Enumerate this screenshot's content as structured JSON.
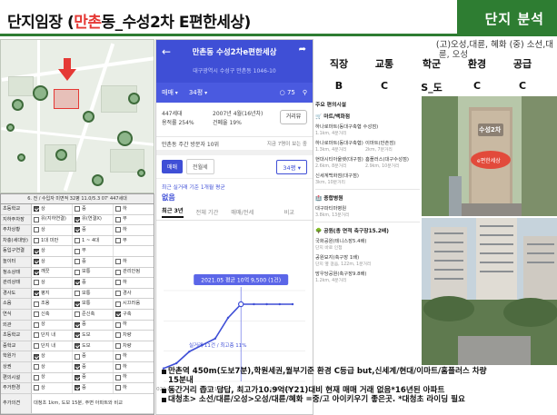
{
  "header": {
    "title_prefix": "단지임장 (",
    "title_highlight": "만촌",
    "title_rest": "동_수성2차 E편한세상)",
    "section_label": "단지 분석"
  },
  "description": {
    "line1": "(고)오성,대륜, 혜화 (중) 소선,대",
    "line2": "륜, 오성"
  },
  "grades": {
    "headers": [
      "직장",
      "교통",
      "학군",
      "환경",
      "공급"
    ],
    "values": [
      "B",
      "C",
      "S_도",
      "C",
      "C"
    ]
  },
  "checklist": {
    "header": "6. 전 / 수입자 미면적 32평 11.0/5.3 07' 447세대",
    "rows": [
      {
        "label": "초등학교",
        "cells": [
          {
            "text": "상",
            "checked": true
          },
          {
            "text": "중",
            "checked": false
          },
          {
            "text": "하",
            "checked": false
          }
        ]
      },
      {
        "label": "지하주차장",
        "cells": [
          {
            "text": "유(지하연결)",
            "checked": false
          },
          {
            "text": "유(연결X)",
            "checked": true
          },
          {
            "text": "무",
            "checked": false
          }
        ]
      },
      {
        "label": "주차상황",
        "cells": [
          {
            "text": "상",
            "checked": false
          },
          {
            "text": "중",
            "checked": true
          },
          {
            "text": "하",
            "checked": false
          }
        ]
      },
      {
        "label": "차충(세대당)",
        "cells": [
          {
            "text": "1대 미만",
            "checked": false
          },
          {
            "text": "1 ~ 4대",
            "checked": false
          },
          {
            "text": "무",
            "checked": false
          }
        ]
      },
      {
        "label": "동입구연결",
        "cells": [
          {
            "text": "상",
            "checked": true
          },
          {
            "text": "무",
            "checked": false
          },
          {
            "text": "",
            "checked": false
          }
        ]
      },
      {
        "label": "놀이터",
        "cells": [
          {
            "text": "상",
            "checked": true
          },
          {
            "text": "중",
            "checked": false
          },
          {
            "text": "하",
            "checked": false
          }
        ]
      },
      {
        "label": "청소상태",
        "cells": [
          {
            "text": "깨끗",
            "checked": true
          },
          {
            "text": "보통",
            "checked": false
          },
          {
            "text": "관리안됨",
            "checked": false
          }
        ]
      },
      {
        "label": "관리상태",
        "cells": [
          {
            "text": "상",
            "checked": false
          },
          {
            "text": "중",
            "checked": true
          },
          {
            "text": "하",
            "checked": false
          }
        ]
      },
      {
        "label": "경사도",
        "cells": [
          {
            "text": "평지",
            "checked": true
          },
          {
            "text": "보통",
            "checked": false
          },
          {
            "text": "경사",
            "checked": false
          }
        ]
      },
      {
        "label": "소음",
        "cells": [
          {
            "text": "조용",
            "checked": false
          },
          {
            "text": "보통",
            "checked": true
          },
          {
            "text": "시끄러움",
            "checked": false
          }
        ]
      },
      {
        "label": "연식",
        "cells": [
          {
            "text": "신축",
            "checked": false
          },
          {
            "text": "준신축",
            "checked": false
          },
          {
            "text": "구축",
            "checked": true
          }
        ]
      },
      {
        "label": "외관",
        "cells": [
          {
            "text": "상",
            "checked": false
          },
          {
            "text": "중",
            "checked": true
          },
          {
            "text": "하",
            "checked": false
          }
        ]
      },
      {
        "label": "초등학교",
        "cells": [
          {
            "text": "단지 내",
            "checked": false
          },
          {
            "text": "도보",
            "checked": true
          },
          {
            "text": "차량",
            "checked": false
          }
        ]
      },
      {
        "label": "중학교",
        "cells": [
          {
            "text": "단지 내",
            "checked": false
          },
          {
            "text": "도보",
            "checked": true
          },
          {
            "text": "차량",
            "checked": false
          }
        ]
      },
      {
        "label": "학원가",
        "cells": [
          {
            "text": "상",
            "checked": true
          },
          {
            "text": "중",
            "checked": false
          },
          {
            "text": "하",
            "checked": false
          }
        ]
      },
      {
        "label": "상권",
        "cells": [
          {
            "text": "상",
            "checked": false
          },
          {
            "text": "중",
            "checked": true
          },
          {
            "text": "하",
            "checked": false
          }
        ]
      },
      {
        "label": "편의시설",
        "cells": [
          {
            "text": "상",
            "checked": false
          },
          {
            "text": "중",
            "checked": true
          },
          {
            "text": "하",
            "checked": false
          }
        ]
      },
      {
        "label": "주거환경",
        "cells": [
          {
            "text": "상",
            "checked": false
          },
          {
            "text": "중",
            "checked": true
          },
          {
            "text": "하",
            "checked": false
          }
        ]
      }
    ],
    "memo_label": "추가의견",
    "memo_text": "대청초 1km, 도보 15분, 주변 아파트와 비교"
  },
  "app": {
    "title": "만촌동 수성2차e편한세상",
    "address": "대구광역시 수성구 만촌동 1046-10",
    "filter_type": "매매",
    "filter_size": "34평",
    "comment_count": "75",
    "households": "447세대",
    "floor_area_ratio": "용적률 254%",
    "build_date": "2007년 4월(16년차)",
    "coverage_ratio": "건폐율 19%",
    "distance_button": "거리뷰",
    "visitors_label": "만촌동 주간 방문자 10위",
    "visitors_more": "지금 7명이 보는 중",
    "tab_sale": "매매",
    "tab_rent": "전월세",
    "size_selector": "34평",
    "recent_price_label": "최근 실거래 기준 1개월 평균",
    "recent_price_value": "없음",
    "period_tabs": [
      "최근 3년",
      "전체 기간",
      "매매/전세",
      "비교"
    ],
    "tooltip": "2021.05 평균 10억 9,500 (1건)",
    "chart_note": "실거래 11건 / 최고층 11%"
  },
  "chart_data": {
    "type": "line",
    "title": "",
    "xlabel": "",
    "ylabel": "",
    "x": [
      "2020.01",
      "2020.04",
      "2020.07",
      "2020.10",
      "2021.01",
      "2021.03",
      "2021.05",
      "2021.08",
      "2021.11",
      "2022.01",
      "2022.04"
    ],
    "series": [
      {
        "values": [
          6.0,
          6.4,
          7.3,
          7.8,
          8.3,
          9.9,
          10.95,
          10.95,
          10.95,
          10.95,
          10.95
        ]
      }
    ],
    "x_ticks": [
      "2020.01",
      "2021.01",
      "2022.01"
    ],
    "ylim": [
      5,
      12
    ],
    "highlight_point": {
      "x": "2021.05",
      "y": 10.95
    }
  },
  "facilities": {
    "section_title": "주요 편의시설",
    "mart_title": "마트/백화점",
    "marts": [
      {
        "name": "하나로마트(동대구축협 수성점)",
        "dist": "1.1km, 4분거리"
      },
      {
        "name": "하나로마트(동대구축협)",
        "dist": "1.3km, 4분거리"
      },
      {
        "name": "현대시티아울렛(대구점)",
        "dist": "2.6km, 8분거리"
      },
      {
        "name": "신세계백화점(대구점)",
        "dist": "3km, 10분거리"
      }
    ],
    "marts_right": [
      {
        "name": "이마트(만촌점)",
        "dist": "2km, 7분거리"
      },
      {
        "name": "홈플러스(대구수성점)",
        "dist": "2.9km, 10분거리"
      }
    ],
    "hospital_title": "종합병원",
    "hospital": {
      "name": "대구파티마병원",
      "dist": "3.8km, 13분거리"
    },
    "park_title": "공원(총 면적 축구장15.2배)",
    "parks": [
      {
        "name": "국화공원(테니스장5.4배)",
        "dist": "단지 바로 인접"
      },
      {
        "name": "공원묘지(축구장 1배)",
        "dist": "단지 옆 걸음, 122m, 1분거리"
      },
      {
        "name": "망우당공원(축구장9.8배)",
        "dist": "1.2km, 4분거리"
      }
    ]
  },
  "photos": {
    "sign_text": "수성2차",
    "sign_brand": "e편한세상"
  },
  "notes": [
    {
      "bullet": true,
      "text": "만촌역 450m(도보7분),학원세권,월부기준 환경 C등급 but,신세계/현대/이마트/홈플러스 차량"
    },
    {
      "bullet": false,
      "text": "15분내"
    },
    {
      "bullet": true,
      "text": "동간거리 좁고 답답, 최고가10.9억(Y21)대비 현재 매매 거래 없음*16년된 아파트"
    },
    {
      "bullet": true,
      "text": "대청초> 소선/대륜/오성>오성/대륜/혜화 =중/고 아이키우기 좋은곳. *대청초 라이딩 필요"
    }
  ],
  "colors": {
    "accent_green": "#2e7d32",
    "app_blue": "#3f4fd6",
    "highlight_red": "#e53935"
  }
}
